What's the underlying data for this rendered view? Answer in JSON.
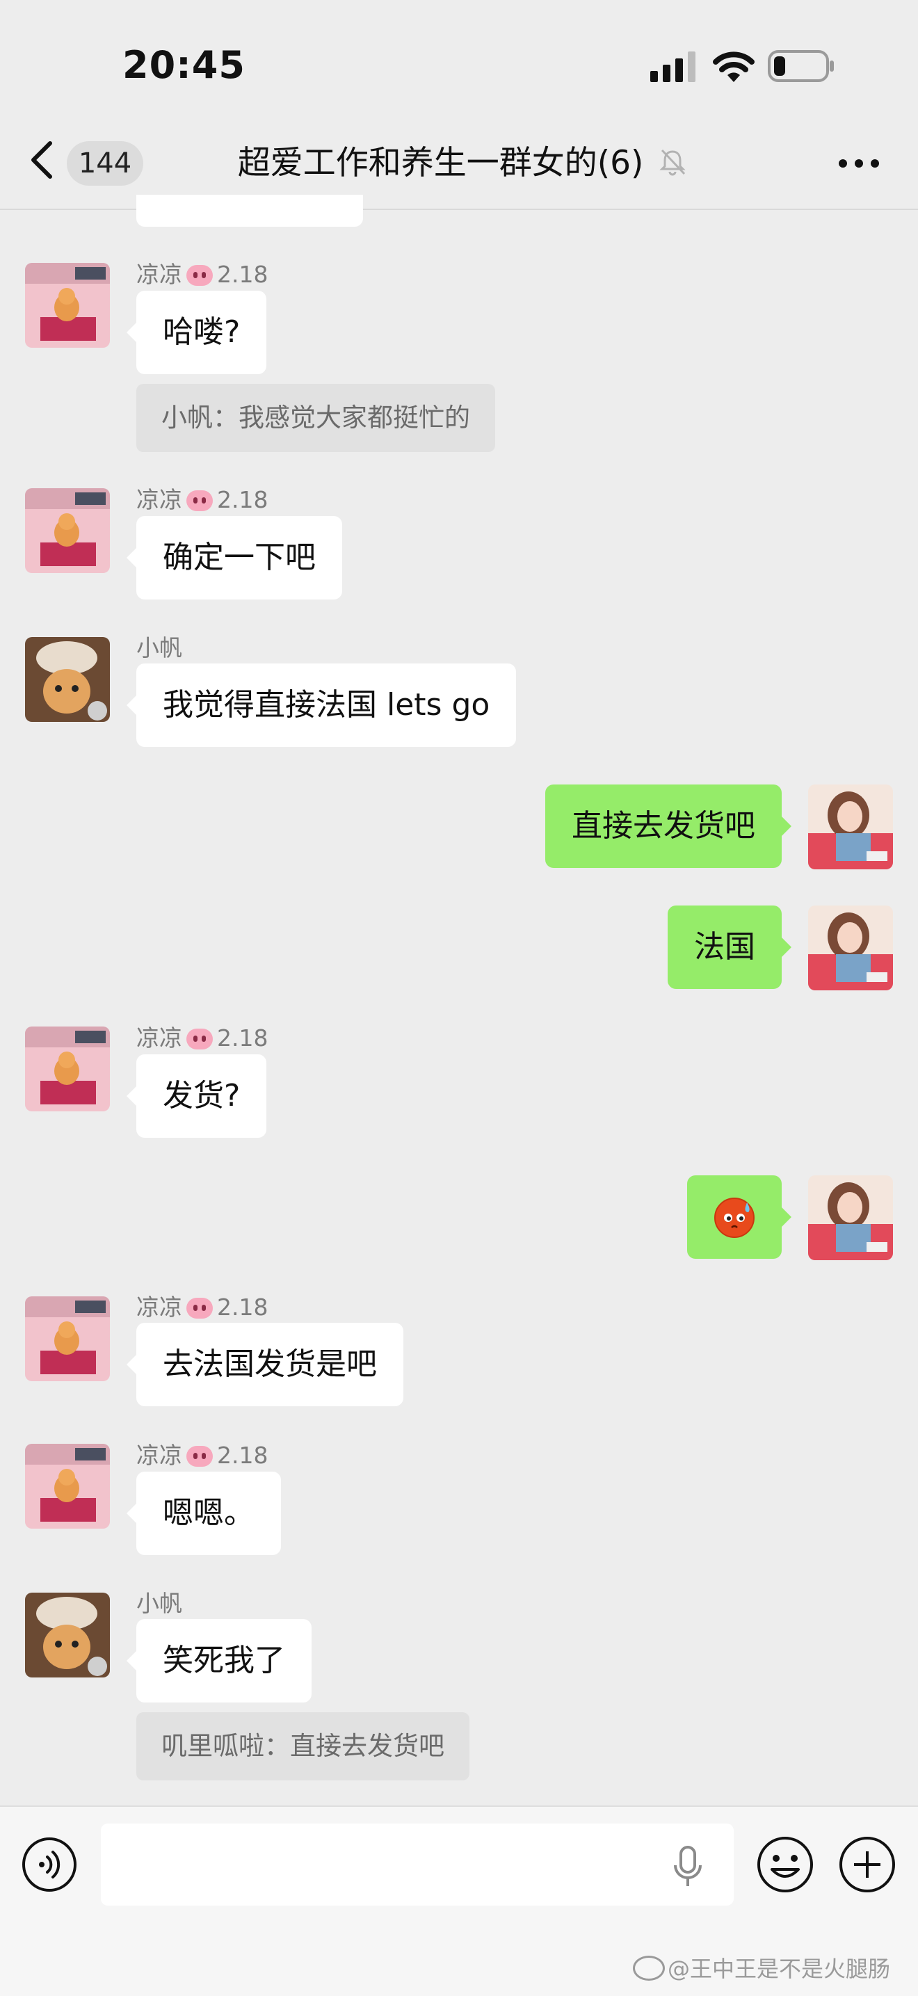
{
  "status_bar": {
    "time": "20:45"
  },
  "nav": {
    "back_count": "144",
    "title": "超爱工作和养生一群女的(6)"
  },
  "messages": [
    {
      "sender": "凉凉",
      "sender_suffix": "2.18",
      "text": "哈喽?"
    },
    {
      "quote": "小帆：我感觉大家都挺忙的"
    },
    {
      "sender": "凉凉",
      "sender_suffix": "2.18",
      "text": "确定一下吧"
    },
    {
      "sender": "小帆",
      "text": "我觉得直接法国 lets go"
    },
    {
      "text": "直接去发货吧"
    },
    {
      "text": "法国"
    },
    {
      "sender": "凉凉",
      "sender_suffix": "2.18",
      "text": "发货?"
    },
    {
      "emoji": "sweat-face"
    },
    {
      "sender": "凉凉",
      "sender_suffix": "2.18",
      "text": "去法国发货是吧"
    },
    {
      "sender": "凉凉",
      "sender_suffix": "2.18",
      "text": "嗯嗯。"
    },
    {
      "sender": "小帆",
      "text": "笑死我了"
    },
    {
      "quote": "叽里呱啦：直接去发货吧"
    }
  ],
  "watermark": "@王中王是不是火腿肠",
  "colors": {
    "self_bubble": "#95ec69",
    "other_bubble": "#ffffff",
    "background": "#ededed"
  }
}
